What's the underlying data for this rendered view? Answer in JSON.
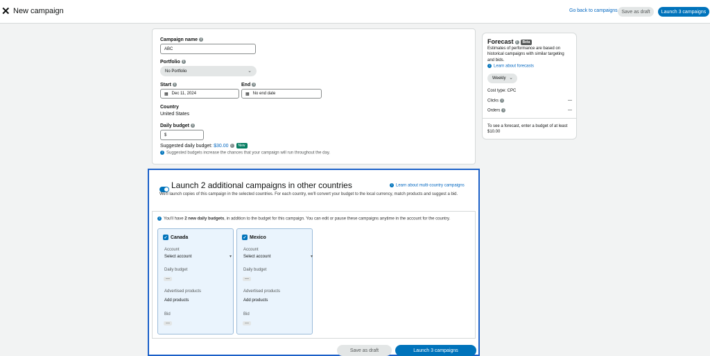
{
  "header": {
    "title": "New campaign",
    "go_back": "Go back to campaigns",
    "save_draft": "Save as draft",
    "launch": "Launch 3 campaigns"
  },
  "settings": {
    "campaign_name_label": "Campaign name",
    "campaign_name_value": "ABC",
    "portfolio_label": "Portfolio",
    "portfolio_value": "No Portfolio",
    "start_label": "Start",
    "start_value": "Dec 11, 2024",
    "end_label": "End",
    "end_value": "No end date",
    "country_label": "Country",
    "country_value": "United States",
    "daily_budget_label": "Daily budget",
    "daily_budget_value": "$",
    "suggested_label": "Suggested daily budget:",
    "suggested_value": "$30.00",
    "new_badge": "New",
    "suggested_note": "Suggested budgets increase the chances that your campaign will run throughout the day."
  },
  "forecast": {
    "title": "Forecast",
    "beta": "Beta",
    "description": "Estimates of performance are based on historical campaigns with similar targeting and bids.",
    "learn": "Learn about forecasts",
    "period": "Weekly",
    "cost_type": "Cost type: CPC",
    "clicks_label": "Clicks",
    "clicks_value": "—",
    "orders_label": "Orders",
    "orders_value": "—",
    "note": "To see a forecast, enter a budget of at least $10.00"
  },
  "multi": {
    "title": "Launch 2 additional campaigns in other countries",
    "learn": "Learn about multi-country campaigns",
    "desc": "We'll launch copies of this campaign in the selected countries. For each country, we'll convert your budget to the local currency, match products and suggest a bid.",
    "notice_pre": "You'll have ",
    "notice_bold": "2 new daily budgets",
    "notice_post": ", in addition to the budget for this campaign. You can edit or pause these campaigns anytime in the account for the country.",
    "countries": [
      {
        "name": "Canada",
        "account_label": "Account",
        "account_value": "Select account",
        "budget_label": "Daily budget",
        "budget_value": "—",
        "products_label": "Advertised products",
        "products_value": "Add products",
        "bid_label": "Bid",
        "bid_value": "—"
      },
      {
        "name": "Mexico",
        "account_label": "Account",
        "account_value": "Select account",
        "budget_label": "Daily budget",
        "budget_value": "—",
        "products_label": "Advertised products",
        "products_value": "Add products",
        "bid_label": "Bid",
        "bid_value": "—"
      }
    ],
    "save_draft": "Save as draft",
    "launch": "Launch 3 campaigns"
  },
  "colors": {
    "accent": "#0073bb",
    "highlight_border": "#1a5fc8"
  }
}
